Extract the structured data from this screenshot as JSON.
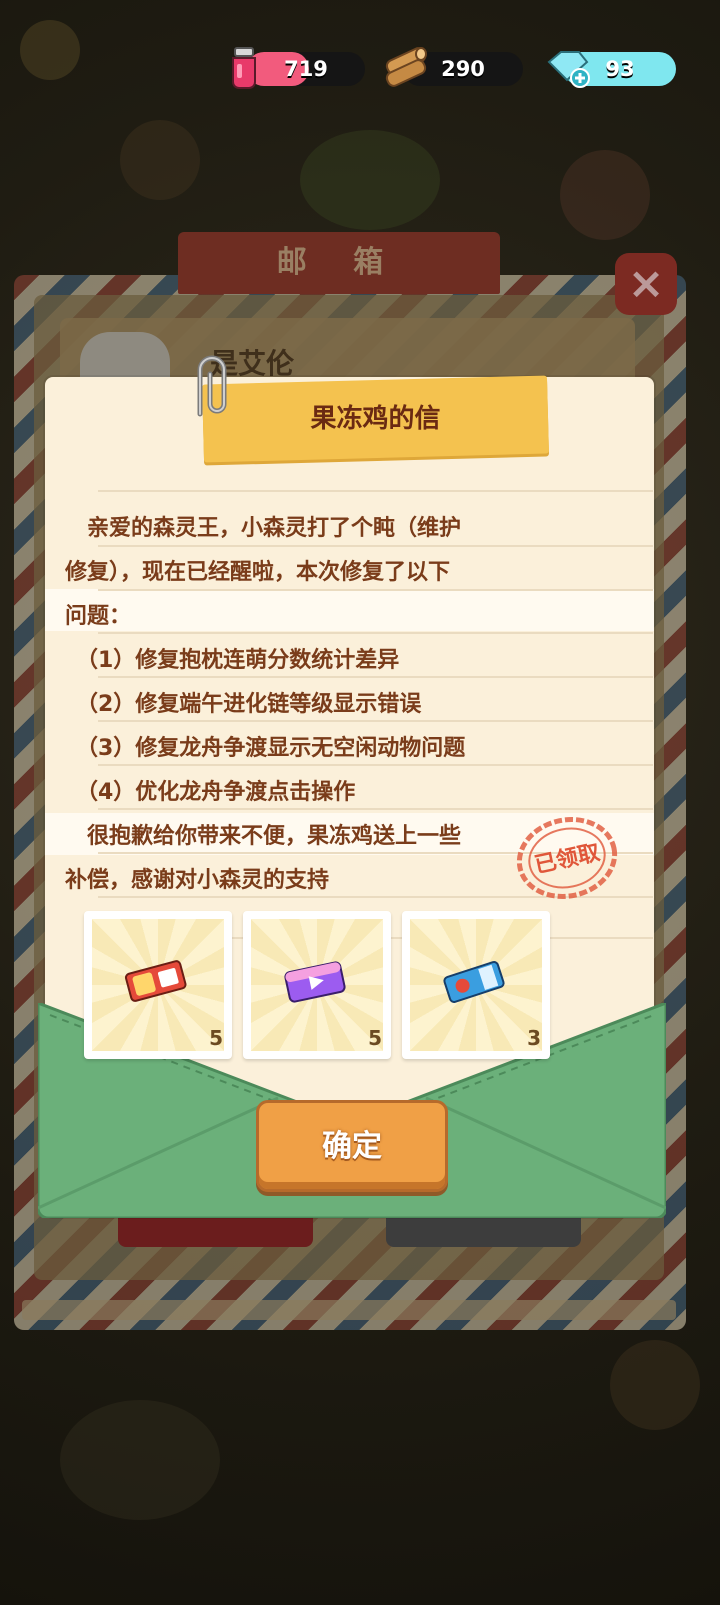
{
  "top_bar": {
    "resources": [
      {
        "icon": "potion-icon",
        "value": "719",
        "color": "#f25b7d"
      },
      {
        "icon": "wood-log-icon",
        "value": "290",
        "color": "#d39a52"
      },
      {
        "icon": "gem-plus-icon",
        "value": "93",
        "color": "#7fe7ef"
      }
    ]
  },
  "mailbox": {
    "title": "邮 箱",
    "mail_sender_partial": "是艾伦"
  },
  "letter": {
    "title": "果冻鸡的信",
    "lines": [
      "　亲爱的森灵王，小森灵打了个盹（维护",
      "修复），现在已经醒啦，本次修复了以下",
      "问题：",
      "　（1）修复抱枕连萌分数统计差异",
      "　（2）修复端午进化链等级显示错误",
      "　（3）修复龙舟争渡显示无空闲动物问题",
      "　（4）优化龙舟争渡点击操作",
      "　很抱歉给你带来不便，果冻鸡送上一些",
      "补偿，感谢对小森灵的支持"
    ],
    "stamp_text": "已领取"
  },
  "rewards": [
    {
      "name": "ticket-icon",
      "count": "5"
    },
    {
      "name": "video-ticket-icon",
      "count": "5"
    },
    {
      "name": "blue-ticket-icon",
      "count": "3"
    }
  ],
  "confirm_button": "确定",
  "colors": {
    "letter_text": "#7a3c1a",
    "ribbon": "#f4c24f",
    "envelope": "#6bb07a",
    "button": "#f0a046"
  }
}
